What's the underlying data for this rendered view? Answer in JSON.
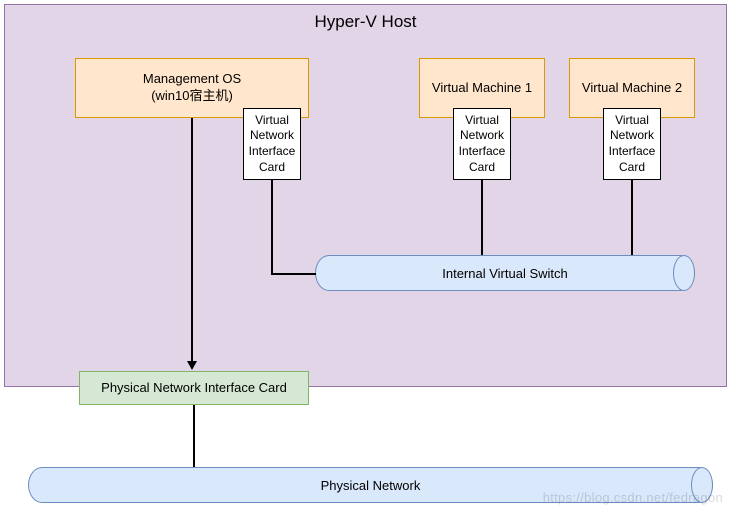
{
  "host": {
    "title": "Hyper-V Host"
  },
  "management_os": {
    "line1": "Management OS",
    "line2": "(win10宿主机)"
  },
  "vnic_label": {
    "l1": "Virtual",
    "l2": "Network",
    "l3": "Interface",
    "l4": "Card"
  },
  "vm1": {
    "label": "Virtual Machine 1"
  },
  "vm2": {
    "label": "Virtual Machine 2"
  },
  "internal_switch": {
    "label": "Internal Virtual Switch"
  },
  "pnic": {
    "label": "Physical Network Interface Card"
  },
  "physical_network": {
    "label": "Physical Network"
  },
  "watermark": "https://blog.csdn.net/fedragon"
}
